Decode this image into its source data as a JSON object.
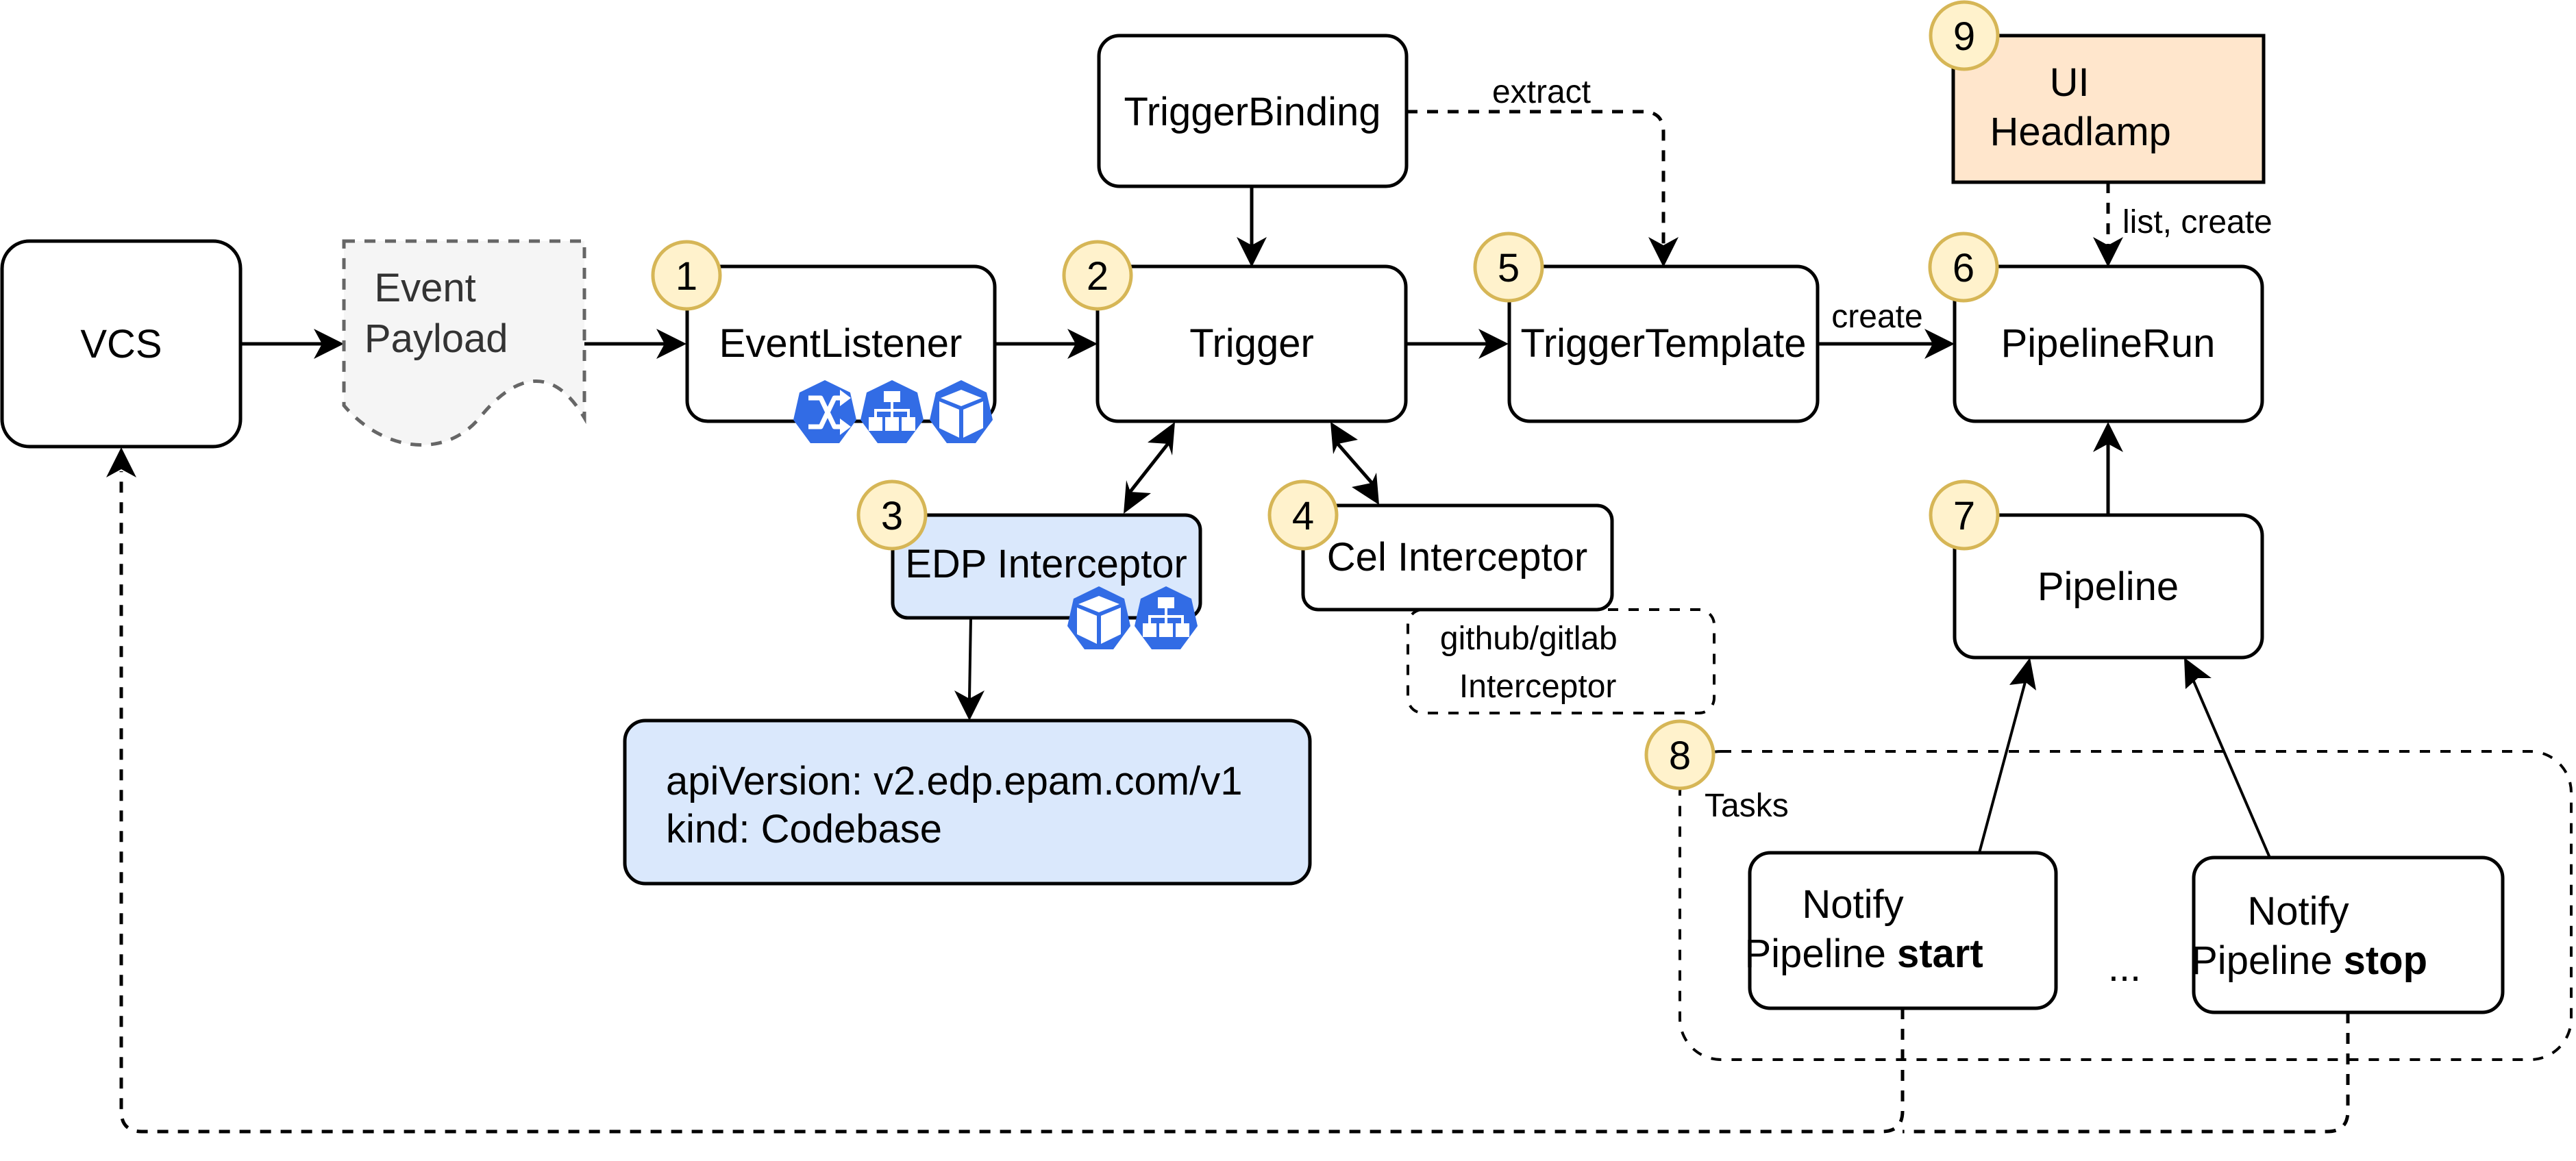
{
  "diagram": {
    "colors": {
      "badge_fill": "#fff2cc",
      "badge_stroke": "#d6b656",
      "interceptor_fill": "#dae8fc",
      "headlamp_fill": "#ffe6cc",
      "payload_fill": "#f5f5f5",
      "payload_stroke": "#666666",
      "k8s_icon": "#326ce5"
    },
    "nodes": {
      "vcs": {
        "label": "VCS"
      },
      "event_payload": {
        "line1": "Event",
        "line2": "Payload"
      },
      "event_listener": {
        "badge": "1",
        "label": "EventListener",
        "icons": [
          "ingress-icon",
          "service-icon",
          "pod-icon"
        ]
      },
      "trigger": {
        "badge": "2",
        "label": "Trigger"
      },
      "trigger_binding": {
        "label": "TriggerBinding"
      },
      "edp_interceptor": {
        "badge": "3",
        "label": "EDP Interceptor",
        "icons": [
          "pod-icon",
          "service-icon"
        ]
      },
      "codebase": {
        "line1": "apiVersion: v2.edp.epam.com/v1",
        "line2": "kind: Codebase"
      },
      "cel_interceptor": {
        "badge": "4",
        "label": "Cel Interceptor"
      },
      "vcs_interceptor": {
        "line1": "github/gitlab",
        "line2": "Interceptor"
      },
      "trigger_template": {
        "badge": "5",
        "label": "TriggerTemplate"
      },
      "pipeline_run": {
        "badge": "6",
        "label": "PipelineRun"
      },
      "pipeline": {
        "badge": "7",
        "label": "Pipeline"
      },
      "tasks_group": {
        "badge": "8",
        "label": "Tasks",
        "ellipsis": "..."
      },
      "notify_start": {
        "line1": "Notify",
        "line2_plain": "Pipeline ",
        "line2_bold": "start"
      },
      "notify_stop": {
        "line1": "Notify",
        "line2_plain": "Pipeline ",
        "line2_bold": "stop"
      },
      "ui_headlamp": {
        "badge": "9",
        "line1": "UI",
        "line2": "Headlamp"
      }
    },
    "edges": {
      "extract": "extract",
      "create": "create",
      "list_create": "list, create"
    }
  }
}
